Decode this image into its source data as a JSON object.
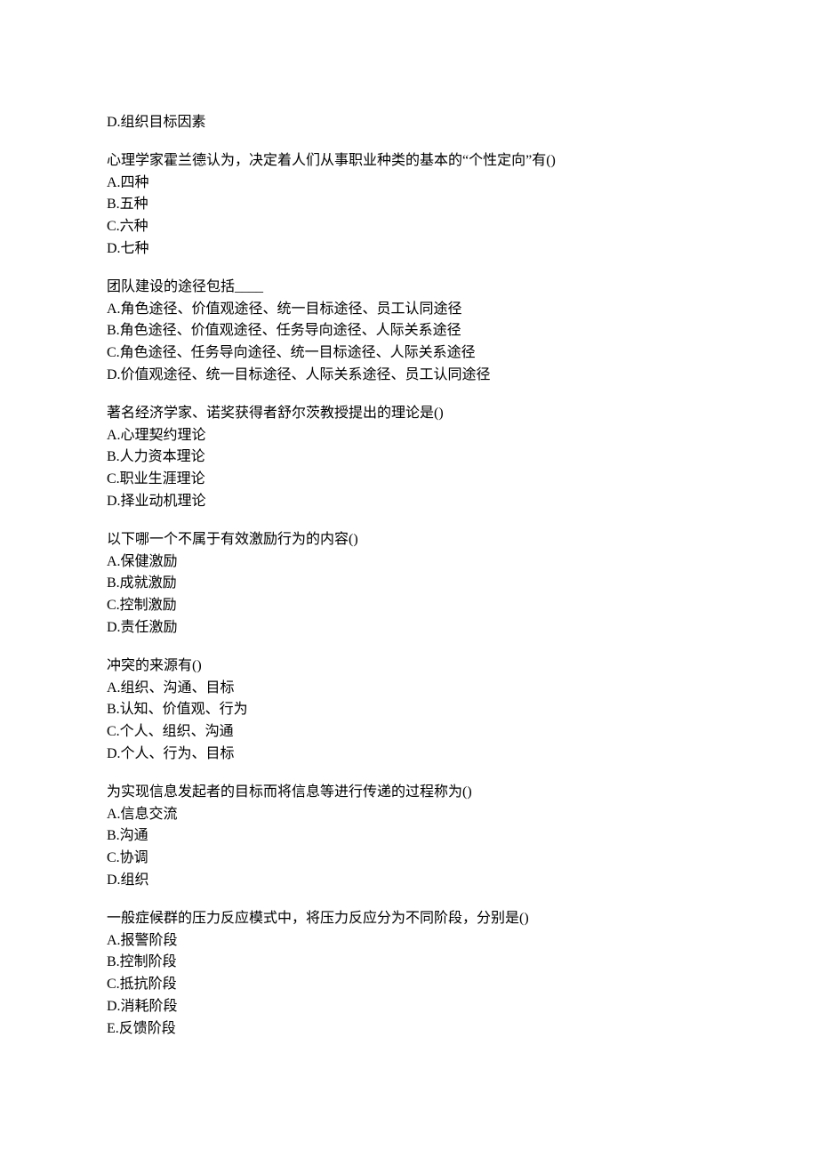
{
  "strayOption": "D.组织目标因素",
  "questions": [
    {
      "stem": "心理学家霍兰德认为，决定着人们从事职业种类的基本的“个性定向”有()",
      "options": [
        "A.四种",
        "B.五种",
        "C.六种",
        "D.七种"
      ]
    },
    {
      "stem": "团队建设的途径包括____",
      "options": [
        "A.角色途径、价值观途径、统一目标途径、员工认同途径",
        "B.角色途径、价值观途径、任务导向途径、人际关系途径",
        "C.角色途径、任务导向途径、统一目标途径、人际关系途径",
        "D.价值观途径、统一目标途径、人际关系途径、员工认同途径"
      ]
    },
    {
      "stem": "著名经济学家、诺奖获得者舒尔茨教授提出的理论是()",
      "options": [
        "A.心理契约理论",
        "B.人力资本理论",
        "C.职业生涯理论",
        "D.择业动机理论"
      ]
    },
    {
      "stem": "以下哪一个不属于有效激励行为的内容()",
      "options": [
        "A.保健激励",
        "B.成就激励",
        "C.控制激励",
        "D.责任激励"
      ]
    },
    {
      "stem": "冲突的来源有()",
      "options": [
        "A.组织、沟通、目标",
        "B.认知、价值观、行为",
        "C.个人、组织、沟通",
        "D.个人、行为、目标"
      ]
    },
    {
      "stem": "为实现信息发起者的目标而将信息等进行传递的过程称为()",
      "options": [
        "A.信息交流",
        "B.沟通",
        "C.协调",
        "D.组织"
      ]
    },
    {
      "stem": "一般症候群的压力反应模式中，将压力反应分为不同阶段，分别是()",
      "options": [
        "A.报警阶段",
        "B.控制阶段",
        "C.抵抗阶段",
        "D.消耗阶段",
        "E.反馈阶段"
      ]
    }
  ]
}
